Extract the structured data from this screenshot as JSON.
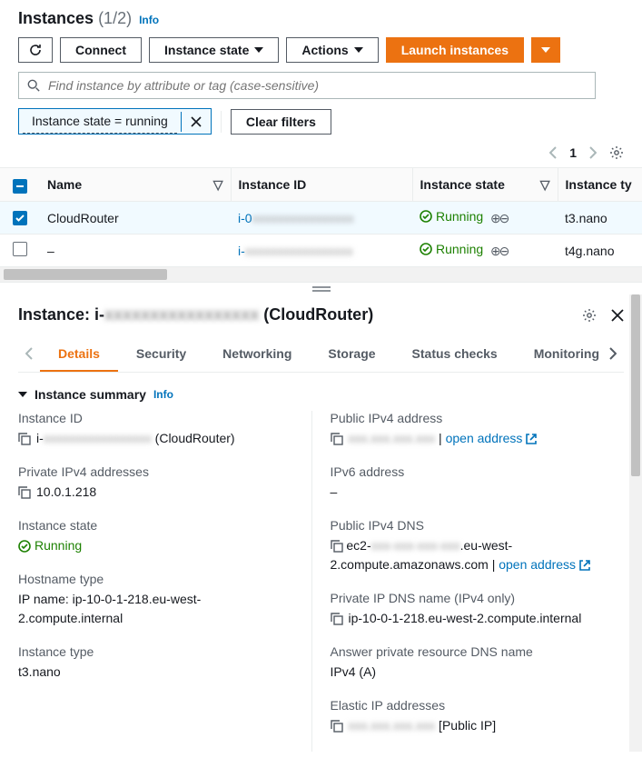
{
  "header": {
    "title": "Instances",
    "count": "(1/2)",
    "info": "Info"
  },
  "toolbar": {
    "connect": "Connect",
    "instance_state": "Instance state",
    "actions": "Actions",
    "launch": "Launch instances"
  },
  "search": {
    "placeholder": "Find instance by attribute or tag (case-sensitive)"
  },
  "filters": {
    "token": "Instance state = running",
    "clear": "Clear filters"
  },
  "pager": {
    "page": "1"
  },
  "table": {
    "columns": {
      "name": "Name",
      "instance_id": "Instance ID",
      "instance_state": "Instance state",
      "instance_type": "Instance ty"
    },
    "rows": [
      {
        "selected": true,
        "name": "CloudRouter",
        "id_prefix": "i-0",
        "id_hidden": "xxxxxxxxxxxxxxxx",
        "state": "Running",
        "type": "t3.nano"
      },
      {
        "selected": false,
        "name": "–",
        "id_prefix": "i-",
        "id_hidden": "xxxxxxxxxxxxxxxxx",
        "state": "Running",
        "type": "t4g.nano"
      }
    ]
  },
  "detail": {
    "title_prefix": "Instance: i-",
    "title_hidden": "xxxxxxxxxxxxxxxxx",
    "title_suffix": " (CloudRouter)",
    "tabs": [
      "Details",
      "Security",
      "Networking",
      "Storage",
      "Status checks",
      "Monitoring"
    ],
    "section": "Instance summary",
    "info": "Info",
    "fields": {
      "instance_id_label": "Instance ID",
      "instance_id_prefix": "i-",
      "instance_id_hidden": "xxxxxxxxxxxxxxxxx",
      "instance_id_suffix": " (CloudRouter)",
      "public_ipv4_label": "Public IPv4 address",
      "public_ipv4_hidden": "xxx.xxx.xxx.xxx",
      "open_address": "open address",
      "private_ipv4_label": "Private IPv4 addresses",
      "private_ipv4_value": "10.0.1.218",
      "ipv6_label": "IPv6 address",
      "ipv6_value": "–",
      "instance_state_label": "Instance state",
      "instance_state_value": "Running",
      "public_dns_label": "Public IPv4 DNS",
      "public_dns_prefix": "ec2-",
      "public_dns_hidden": "xxx-xxx-xxx-xxx",
      "public_dns_suffix": ".eu-west-2.compute.amazonaws.com | ",
      "hostname_type_label": "Hostname type",
      "hostname_type_value": "IP name: ip-10-0-1-218.eu-west-2.compute.internal",
      "private_dns_label": "Private IP DNS name (IPv4 only)",
      "private_dns_value": "ip-10-0-1-218.eu-west-2.compute.internal",
      "answer_dns_label": "Answer private resource DNS name",
      "answer_dns_value": "IPv4 (A)",
      "instance_type_label": "Instance type",
      "instance_type_value": "t3.nano",
      "elastic_ip_label": "Elastic IP addresses",
      "elastic_ip_hidden": "xxx.xxx.xxx.xxx",
      "elastic_ip_suffix": " [Public IP]"
    }
  }
}
